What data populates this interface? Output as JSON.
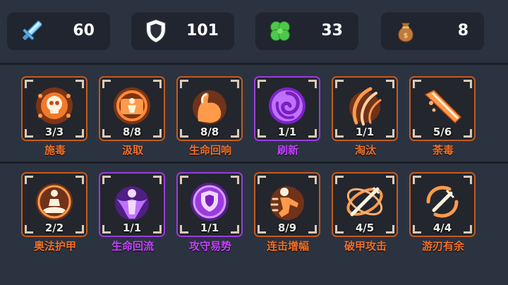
{
  "resources": [
    {
      "icon": "sword-icon",
      "value": "60"
    },
    {
      "icon": "shield-icon",
      "value": "101"
    },
    {
      "icon": "clover-icon",
      "value": "33"
    },
    {
      "icon": "money-bag-icon",
      "value": "8"
    }
  ],
  "rows": [
    [
      {
        "name": "施毒",
        "level": "3/3",
        "icon": "poison-skull-icon",
        "rarity": "orange"
      },
      {
        "name": "汲取",
        "level": "8/8",
        "icon": "drain-figure-icon",
        "rarity": "orange"
      },
      {
        "name": "生命回响",
        "level": "8/8",
        "icon": "flexed-arm-icon",
        "rarity": "orange"
      },
      {
        "name": "刷新",
        "level": "1/1",
        "icon": "swirl-icon",
        "rarity": "purple"
      },
      {
        "name": "淘汰",
        "level": "1/1",
        "icon": "slash-claw-icon",
        "rarity": "orange"
      },
      {
        "name": "荼毒",
        "level": "5/6",
        "icon": "toxic-blade-icon",
        "rarity": "orange"
      }
    ],
    [
      {
        "name": "奥法护甲",
        "level": "2/2",
        "icon": "meditation-icon",
        "rarity": "orange"
      },
      {
        "name": "生命回流",
        "level": "1/1",
        "icon": "angel-figure-icon",
        "rarity": "purple"
      },
      {
        "name": "攻守易势",
        "level": "1/1",
        "icon": "spiked-shield-icon",
        "rarity": "purple"
      },
      {
        "name": "连击增幅",
        "level": "8/9",
        "icon": "punch-icon",
        "rarity": "orange"
      },
      {
        "name": "破甲攻击",
        "level": "4/5",
        "icon": "orbit-sword-icon",
        "rarity": "orange"
      },
      {
        "name": "游刃有余",
        "level": "4/4",
        "icon": "whirl-blade-icon",
        "rarity": "orange"
      }
    ]
  ],
  "colors": {
    "orange": "#f07028",
    "purple": "#c444ff",
    "panel": "#20252f",
    "background": "#2c3340"
  }
}
